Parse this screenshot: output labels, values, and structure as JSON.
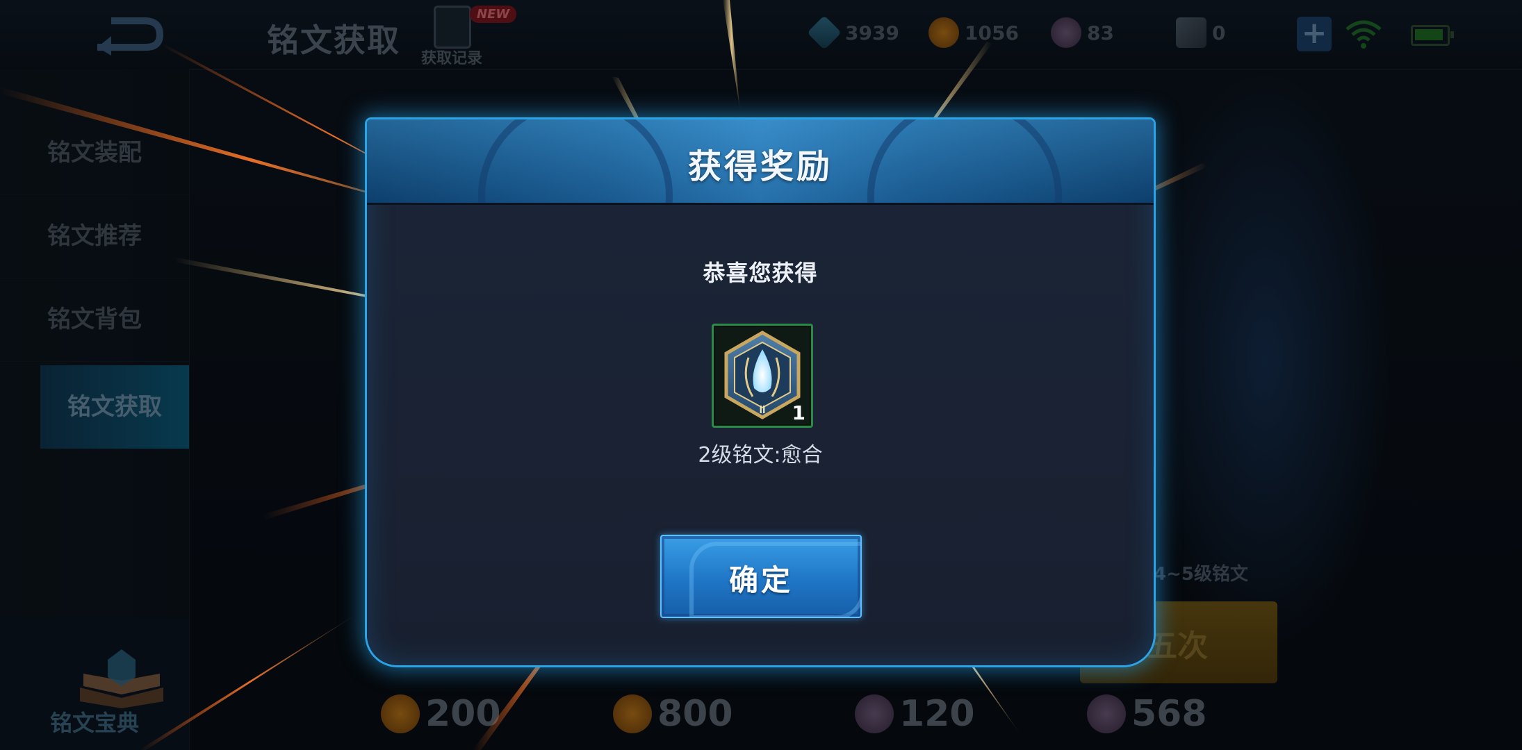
{
  "topbar": {
    "title": "铭文获取",
    "record_label": "获取记录",
    "new_badge": "NEW",
    "currencies": [
      {
        "icon": "diamond-icon",
        "value": "3939"
      },
      {
        "icon": "gold-coin-icon",
        "value": "1056"
      },
      {
        "icon": "gem-icon",
        "value": "83"
      },
      {
        "icon": "ticket-icon",
        "value": "0"
      }
    ],
    "plus_label": "+"
  },
  "sidebar": {
    "items": [
      {
        "label": "铭文装配"
      },
      {
        "label": "铭文推荐"
      },
      {
        "label": "铭文背包"
      },
      {
        "label": "铭文获取"
      }
    ],
    "codex_label": "铭文宝典"
  },
  "shop": {
    "level_text": "4~5级铭文",
    "five_times_label": "五次",
    "prices": [
      {
        "icon": "gold-coin-icon",
        "value": "200"
      },
      {
        "icon": "gold-coin-icon",
        "value": "800"
      },
      {
        "icon": "gem-icon",
        "value": "120"
      },
      {
        "icon": "gem-icon",
        "value": "568"
      }
    ]
  },
  "dialog": {
    "title": "获得奖励",
    "congrats": "恭喜您获得",
    "item": {
      "icon": "inscription-icon",
      "count": "1",
      "name": "2级铭文:愈合"
    },
    "confirm_label": "确定"
  },
  "colors": {
    "dialog_border": "#2aa4e6",
    "confirm_button": "#1f76c6",
    "item_border": "#2a8a48"
  }
}
